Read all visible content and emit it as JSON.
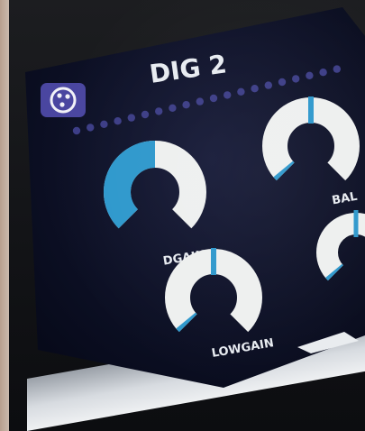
{
  "screen": {
    "title": "DIG 2"
  },
  "knobs": [
    {
      "label": "DGAIN",
      "level": 0.5
    },
    {
      "label": "BAL",
      "level": 0.02
    },
    {
      "label": "LOWGAIN",
      "level": 0.02
    },
    {
      "label": "",
      "level": 0.02
    }
  ],
  "icons": {
    "top_left": "settings-sliders-icon"
  },
  "colors": {
    "screen_bg": "#0b1025",
    "accent": "#2e98cc",
    "knob_track": "#eef0ef",
    "dots": "#3c3d86",
    "text": "#e8ecf1"
  }
}
